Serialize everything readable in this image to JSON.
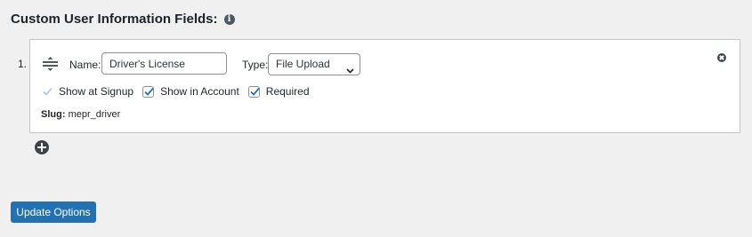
{
  "section": {
    "title": "Custom User Information Fields:",
    "info_icon": "i"
  },
  "field": {
    "index": "1.",
    "name_label": "Name:",
    "name_value": "Driver's License",
    "type_label": "Type:",
    "type_value": "File Upload",
    "checkboxes": [
      {
        "label": "Show at Signup",
        "checked": true,
        "disabled": true
      },
      {
        "label": "Show in Account",
        "checked": true,
        "disabled": false
      },
      {
        "label": "Required",
        "checked": true,
        "disabled": false
      }
    ],
    "slug_label": "Slug:",
    "slug_value": "mepr_driver"
  },
  "actions": {
    "update_label": "Update Options"
  },
  "colors": {
    "primary": "#2271b1",
    "background": "#f0f0f1",
    "icon": "#3c434a"
  },
  "icons": [
    "info-icon",
    "drag-handle-icon",
    "remove-icon",
    "chevron-down-icon",
    "checkmark-icon",
    "add-icon"
  ]
}
